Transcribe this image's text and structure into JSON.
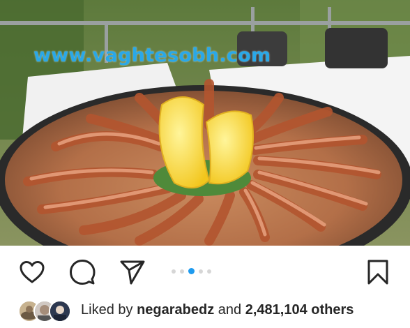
{
  "watermark": "www.vaghtesobh.com",
  "actions": {
    "like_icon": "heart-outline-icon",
    "comment_icon": "comment-bubble-icon",
    "share_icon": "paper-plane-icon",
    "save_icon": "bookmark-outline-icon"
  },
  "carousel": {
    "total": 5,
    "active_index": 2
  },
  "likes": {
    "prefix": "Liked by",
    "username": "negarabedz",
    "conjunction": "and",
    "count": "2,481,104 others"
  },
  "colors": {
    "accent": "#1f9bef",
    "text": "#262626",
    "watermark": "#2aa8e8"
  }
}
